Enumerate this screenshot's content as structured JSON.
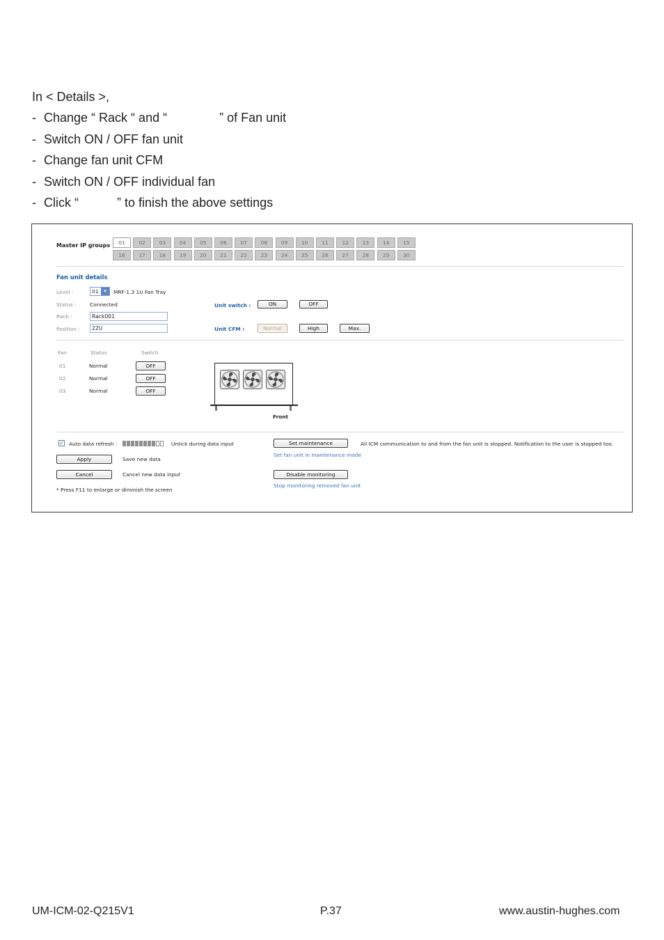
{
  "intro": {
    "line1": "In < Details >,",
    "line2": "Change “ Rack “ and “               ” of Fan unit",
    "line3": "Switch ON / OFF fan unit",
    "line4": "Change fan unit CFM",
    "line5": "Switch ON / OFF individual fan",
    "line6": "Click “           ” to finish the above settings",
    "dash": "-"
  },
  "ui": {
    "master_ip_label": "Master IP groups",
    "groups": [
      "01",
      "02",
      "03",
      "04",
      "05",
      "06",
      "07",
      "08",
      "09",
      "10",
      "11",
      "12",
      "13",
      "14",
      "15",
      "16",
      "17",
      "18",
      "19",
      "20",
      "21",
      "22",
      "23",
      "24",
      "25",
      "26",
      "27",
      "28",
      "29",
      "30"
    ],
    "active_group": "01",
    "section_title": "Fan unit details",
    "level_label": "Level :",
    "level_value": "01",
    "model": "MRF-1.3 1U Fan Tray",
    "status_label": "Status :",
    "status_value": "Connected",
    "rack_label": "Rack :",
    "rack_value": "Rack001",
    "position_label": "Position :",
    "position_value": "22U",
    "unit_switch_label": "Unit switch :",
    "on_label": "ON",
    "off_label": "OFF",
    "unit_cfm_label": "Unit CFM :",
    "cfm_normal": "Normal",
    "cfm_high": "High",
    "cfm_max": "Max.",
    "fan_header": "Fan",
    "status_header": "Status",
    "switch_header": "Switch",
    "fans": [
      {
        "id": "01",
        "status": "Normal",
        "switch": "OFF"
      },
      {
        "id": "02",
        "status": "Normal",
        "switch": "OFF"
      },
      {
        "id": "03",
        "status": "Normal",
        "switch": "OFF"
      }
    ],
    "front_label": "Front",
    "auto_refresh_label": "Auto data refresh :",
    "auto_refresh_checked": "✓",
    "untick_note": "Untick during data input",
    "apply_label": "Apply",
    "apply_desc": "Save new data",
    "cancel_label": "Cancel",
    "cancel_desc": "Cancel new data input",
    "f11_note": "* Press F11 to enlarge or diminish the screen",
    "set_maint_label": "Set maintenance",
    "maint_note": "All ICM communication to and from the fan unit is stopped. Notification to the user is stopped too.",
    "maint_link": "Set fan unit in maintenance mode",
    "disable_label": "Disable monitoring",
    "disable_link": "Stop monitoring removed fan unit"
  },
  "colors": {
    "accent": "#1d5fa6",
    "inactive_group": "#c9c9c9"
  },
  "footer": {
    "left": "UM-ICM-02-Q215V1",
    "center": "P.37",
    "right": "www.austin-hughes.com"
  }
}
